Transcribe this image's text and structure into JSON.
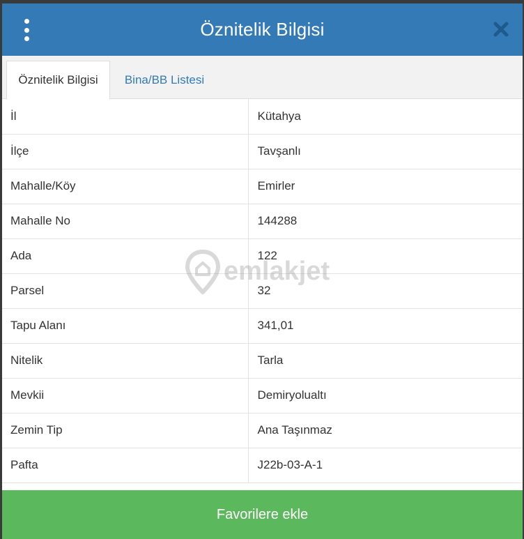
{
  "header": {
    "title": "Öznitelik Bilgisi"
  },
  "tabs": [
    {
      "label": "Öznitelik Bilgisi",
      "active": true
    },
    {
      "label": "Bina/BB Listesi",
      "active": false
    }
  ],
  "rows": [
    {
      "key": "İl",
      "value": "Kütahya"
    },
    {
      "key": "İlçe",
      "value": "Tavşanlı"
    },
    {
      "key": "Mahalle/Köy",
      "value": "Emirler"
    },
    {
      "key": "Mahalle No",
      "value": "144288"
    },
    {
      "key": "Ada",
      "value": "122"
    },
    {
      "key": "Parsel",
      "value": "32"
    },
    {
      "key": "Tapu Alanı",
      "value": "341,01"
    },
    {
      "key": "Nitelik",
      "value": "Tarla"
    },
    {
      "key": "Mevkii",
      "value": "Demiryolualtı"
    },
    {
      "key": "Zemin Tip",
      "value": "Ana Taşınmaz"
    },
    {
      "key": "Pafta",
      "value": "J22b-03-A-1"
    }
  ],
  "watermark": {
    "text": "emlakjet"
  },
  "footer": {
    "button_label": "Favorilere ekle"
  },
  "colors": {
    "header": "#337ab7",
    "link": "#337ab7",
    "button": "#5cb85c"
  },
  "icons": {
    "menu": "vertical-ellipsis-icon",
    "close": "close-icon",
    "watermark": "location-pin-icon"
  }
}
